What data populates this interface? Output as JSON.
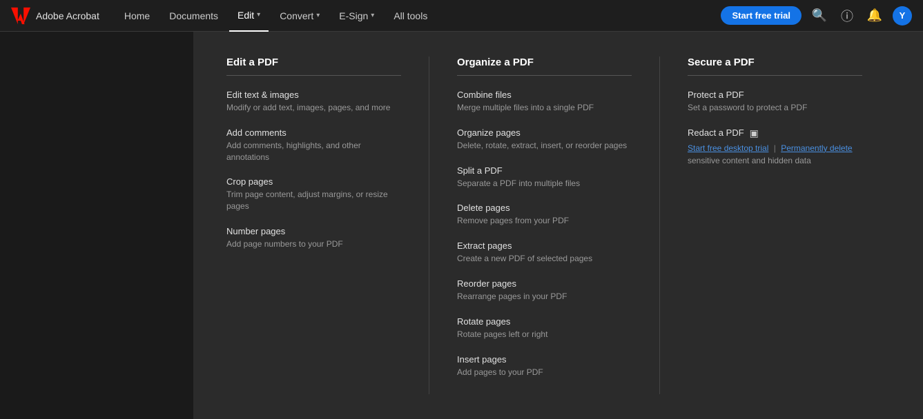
{
  "brand": {
    "logo_alt": "Adobe",
    "name": "Adobe Acrobat"
  },
  "nav": {
    "home": "Home",
    "documents": "Documents",
    "edit": "Edit",
    "convert": "Convert",
    "esign": "E-Sign",
    "alltools": "All tools",
    "trial_button": "Start free trial"
  },
  "dropdown": {
    "edit_a_pdf": {
      "title": "Edit a PDF",
      "items": [
        {
          "title": "Edit text & images",
          "desc": "Modify or add text, images, pages, and more"
        },
        {
          "title": "Add comments",
          "desc": "Add comments, highlights, and other annotations"
        },
        {
          "title": "Crop pages",
          "desc": "Trim page content, adjust margins, or resize pages"
        },
        {
          "title": "Number pages",
          "desc": "Add page numbers to your PDF"
        }
      ]
    },
    "organize_a_pdf": {
      "title": "Organize a PDF",
      "items": [
        {
          "title": "Combine files",
          "desc": "Merge multiple files into a single PDF"
        },
        {
          "title": "Organize pages",
          "desc": "Delete, rotate, extract, insert, or reorder pages"
        },
        {
          "title": "Split a PDF",
          "desc": "Separate a PDF into multiple files"
        },
        {
          "title": "Delete pages",
          "desc": "Remove pages from your PDF"
        },
        {
          "title": "Extract pages",
          "desc": "Create a new PDF of selected pages"
        },
        {
          "title": "Reorder pages",
          "desc": "Rearrange pages in your PDF"
        },
        {
          "title": "Rotate pages",
          "desc": "Rotate pages left or right"
        },
        {
          "title": "Insert pages",
          "desc": "Add pages to your PDF"
        }
      ]
    },
    "secure_a_pdf": {
      "title": "Secure a PDF",
      "items": [
        {
          "title": "Protect a PDF",
          "desc": "Set a password to protect a PDF"
        }
      ],
      "redact": {
        "title": "Redact a PDF",
        "trial_link": "Start free desktop trial",
        "separator": "|",
        "perm_link": "Permanently delete",
        "perm_desc": "sensitive content and hidden data"
      }
    }
  }
}
